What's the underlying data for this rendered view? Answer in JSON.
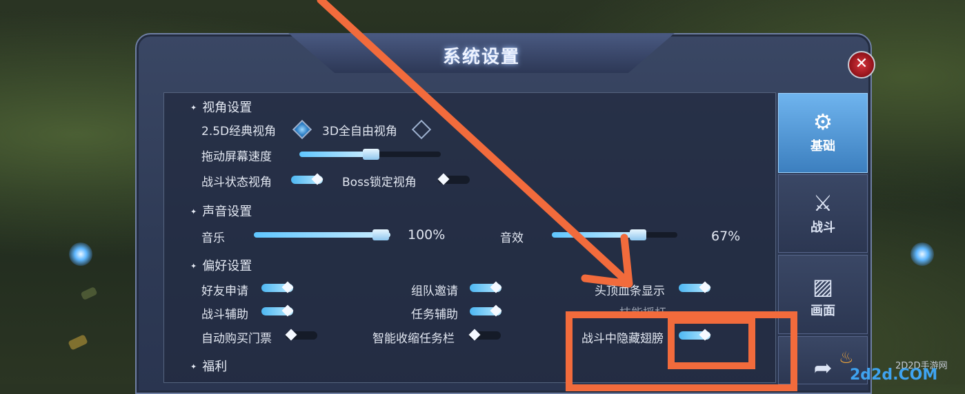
{
  "window": {
    "title": "系统设置",
    "close_icon": "close-icon"
  },
  "sections": {
    "view": "视角设置",
    "sound": "声音设置",
    "prefs": "偏好设置",
    "welfare": "福利"
  },
  "view_settings": {
    "option_25d": "2.5D经典视角",
    "option_3d": "3D全自由视角",
    "selected": "2.5D经典视角",
    "drag_speed_label": "拖动屏幕速度",
    "drag_speed_level": 0.45,
    "battle_view_label": "战斗状态视角",
    "battle_view_on": true,
    "boss_lock_label": "Boss锁定视角",
    "boss_lock_on": false
  },
  "sound_settings": {
    "music_label": "音乐",
    "music_value": "100%",
    "sfx_label": "音效",
    "sfx_value": "67%"
  },
  "prefs": {
    "friend_request": "好友申请",
    "team_invite": "组队邀请",
    "head_bar": "头顶血条显示",
    "battle_assist": "战斗辅助",
    "quest_assist": "任务辅助",
    "partial_hidden": "技能摇杆",
    "auto_ticket": "自动购买门票",
    "collapse_quest": "智能收缩任务栏",
    "hide_wings": "战斗中隐藏翅膀"
  },
  "tabs": [
    {
      "label": "基础",
      "icon": "gear-icon",
      "active": true
    },
    {
      "label": "战斗",
      "icon": "sword-shield-icon",
      "active": false
    },
    {
      "label": "画面",
      "icon": "image-icon",
      "active": false
    },
    {
      "label": "",
      "icon": "share-icon",
      "active": false
    }
  ],
  "watermark": {
    "site": "2D2D手游网",
    "logo": "2d2d.COM"
  },
  "colors": {
    "accent": "#5fc6ff",
    "annotation": "#f26b3c",
    "close": "#d8343c"
  }
}
